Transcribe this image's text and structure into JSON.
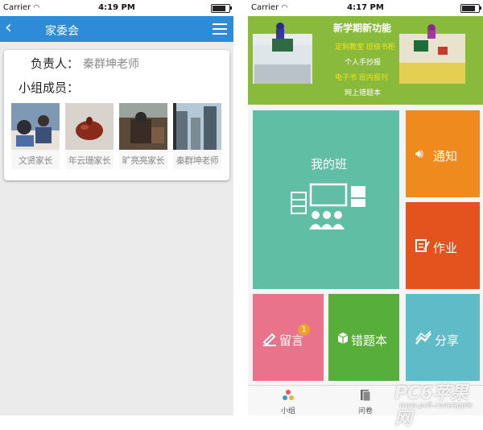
{
  "left_screen": {
    "status": {
      "carrier": "Carrier",
      "time": "4:19 PM"
    },
    "header": {
      "back_icon": "chevron-left-icon",
      "title": "家委会",
      "menu_icon": "hamburger-menu-icon"
    },
    "card": {
      "leader_label": "负责人：",
      "leader_value": "秦群坤老师",
      "members_label": "小组成员：",
      "members": [
        {
          "name": "文贤家长"
        },
        {
          "name": "年云珊家长"
        },
        {
          "name": "旷亮亮家长"
        },
        {
          "name": "秦群坤老师"
        }
      ]
    }
  },
  "right_screen": {
    "status": {
      "carrier": "Carrier",
      "time": "4:17 PM"
    },
    "banner": {
      "title": "新学期新功能",
      "lines": [
        "定制教室",
        "班级书柜",
        "个人手抄报",
        "电子书",
        "班内报刊",
        "网上错题本"
      ]
    },
    "tiles": [
      {
        "label": "我的班",
        "icon": "classroom-icon",
        "color": "#5fbea3"
      },
      {
        "label": "通知",
        "icon": "speaker-icon",
        "color": "#ee8a1e"
      },
      {
        "label": "作业",
        "icon": "homework-icon",
        "color": "#e4531d"
      },
      {
        "label": "留言",
        "icon": "pencil-icon",
        "color": "#e9738a",
        "badge": "1"
      },
      {
        "label": "错题本",
        "icon": "box-icon",
        "color": "#57ae3a"
      },
      {
        "label": "分享",
        "icon": "share-chart-icon",
        "color": "#5fbbc7"
      }
    ],
    "tabbar": [
      {
        "label": "小组",
        "icon": "group-icon"
      },
      {
        "label": "问卷",
        "icon": "document-icon"
      }
    ]
  },
  "watermark": {
    "text": "PC6苹果网",
    "url": "www.pc6.com/apple"
  }
}
